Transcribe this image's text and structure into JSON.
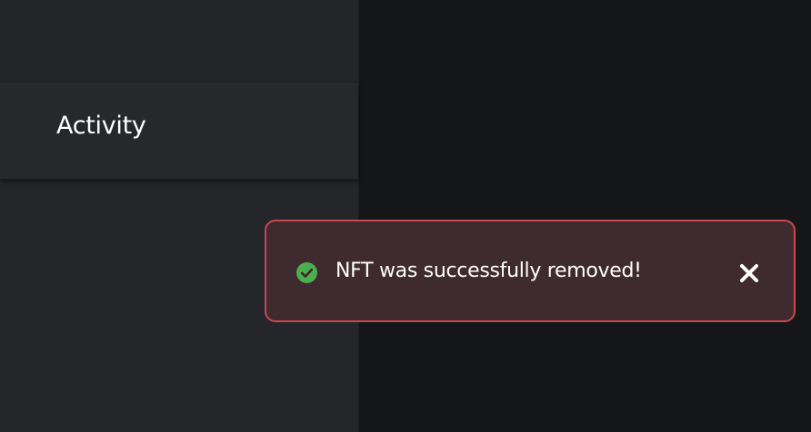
{
  "sidebar": {
    "tab_label": "Activity"
  },
  "toast": {
    "message": "NFT was successfully removed!",
    "status": "success",
    "success_color": "#4cae4f",
    "border_color": "#c9474f",
    "background_color": "#3f2b2f",
    "status_icon": "check-circle-icon",
    "close_icon": "close-icon"
  }
}
